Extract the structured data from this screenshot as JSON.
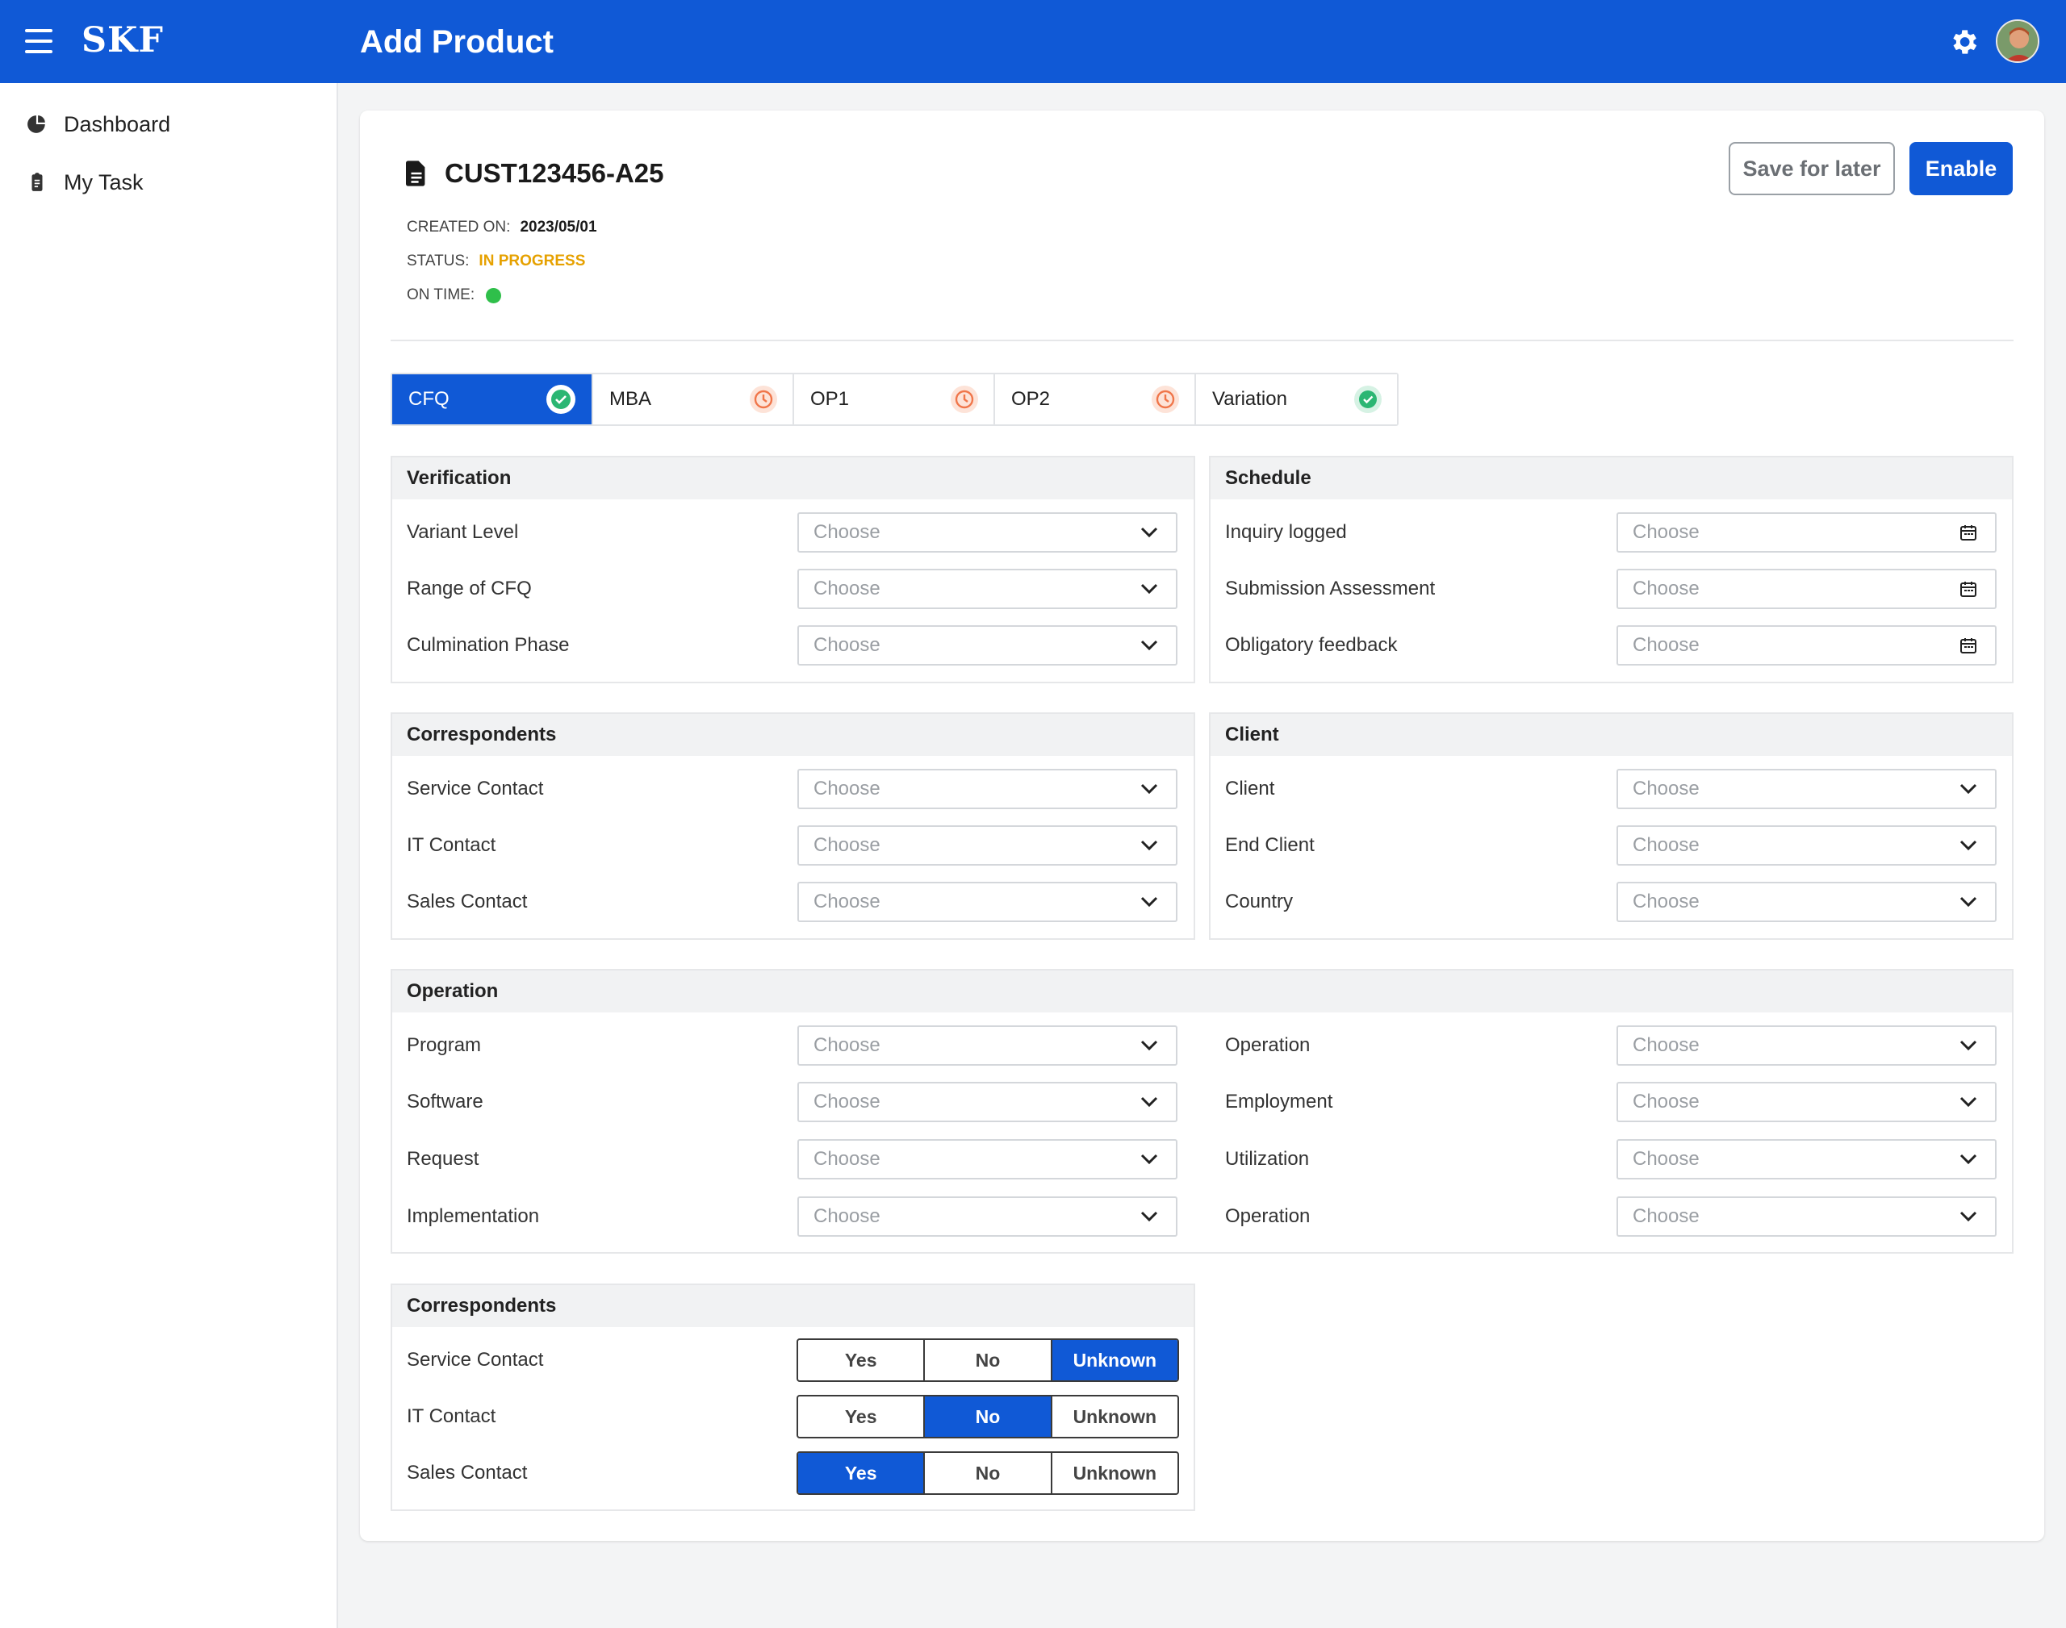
{
  "app": {
    "brand": "SKF",
    "title": "Add Product"
  },
  "sidebar": {
    "items": [
      {
        "label": "Dashboard",
        "icon": "pie-chart-icon"
      },
      {
        "label": "My Task",
        "icon": "clipboard-icon"
      }
    ]
  },
  "document": {
    "id": "CUST123456-A25",
    "created_on_label": "CREATED ON:",
    "created_on": "2023/05/01",
    "status_label": "STATUS:",
    "status": "IN PROGRESS",
    "on_time_label": "ON TIME:"
  },
  "actions": {
    "save_label": "Save for later",
    "enable_label": "Enable"
  },
  "tabs": [
    {
      "label": "CFQ",
      "state": "done"
    },
    {
      "label": "MBA",
      "state": "pending"
    },
    {
      "label": "OP1",
      "state": "pending"
    },
    {
      "label": "OP2",
      "state": "pending"
    },
    {
      "label": "Variation",
      "state": "done"
    }
  ],
  "placeholder": "Choose",
  "verification": {
    "title": "Verification",
    "rows": [
      "Variant Level",
      "Range of CFQ",
      "Culmination Phase"
    ]
  },
  "schedule": {
    "title": "Schedule",
    "rows": [
      "Inquiry logged",
      "Submission Assessment",
      "Obligatory feedback"
    ]
  },
  "correspondents": {
    "title": "Correspondents",
    "rows": [
      "Service Contact",
      "IT Contact",
      "Sales Contact"
    ]
  },
  "client": {
    "title": "Client",
    "rows": [
      "Client",
      "End Client",
      "Country"
    ]
  },
  "operation": {
    "title": "Operation",
    "left_rows": [
      "Program",
      "Software",
      "Request",
      "Implementation"
    ],
    "right_rows": [
      "Operation",
      "Employment",
      "Utilization",
      "Operation"
    ]
  },
  "correspondents2": {
    "title": "Correspondents",
    "options": [
      "Yes",
      "No",
      "Unknown"
    ],
    "rows": [
      {
        "label": "Service Contact",
        "selected": "Unknown"
      },
      {
        "label": "IT Contact",
        "selected": "No"
      },
      {
        "label": "Sales Contact",
        "selected": "Yes"
      }
    ]
  },
  "colors": {
    "primary": "#1059d6",
    "status": "#e6a100",
    "ok": "#2fbf4a",
    "pending": "#f0764a",
    "done": "#2bb673"
  }
}
